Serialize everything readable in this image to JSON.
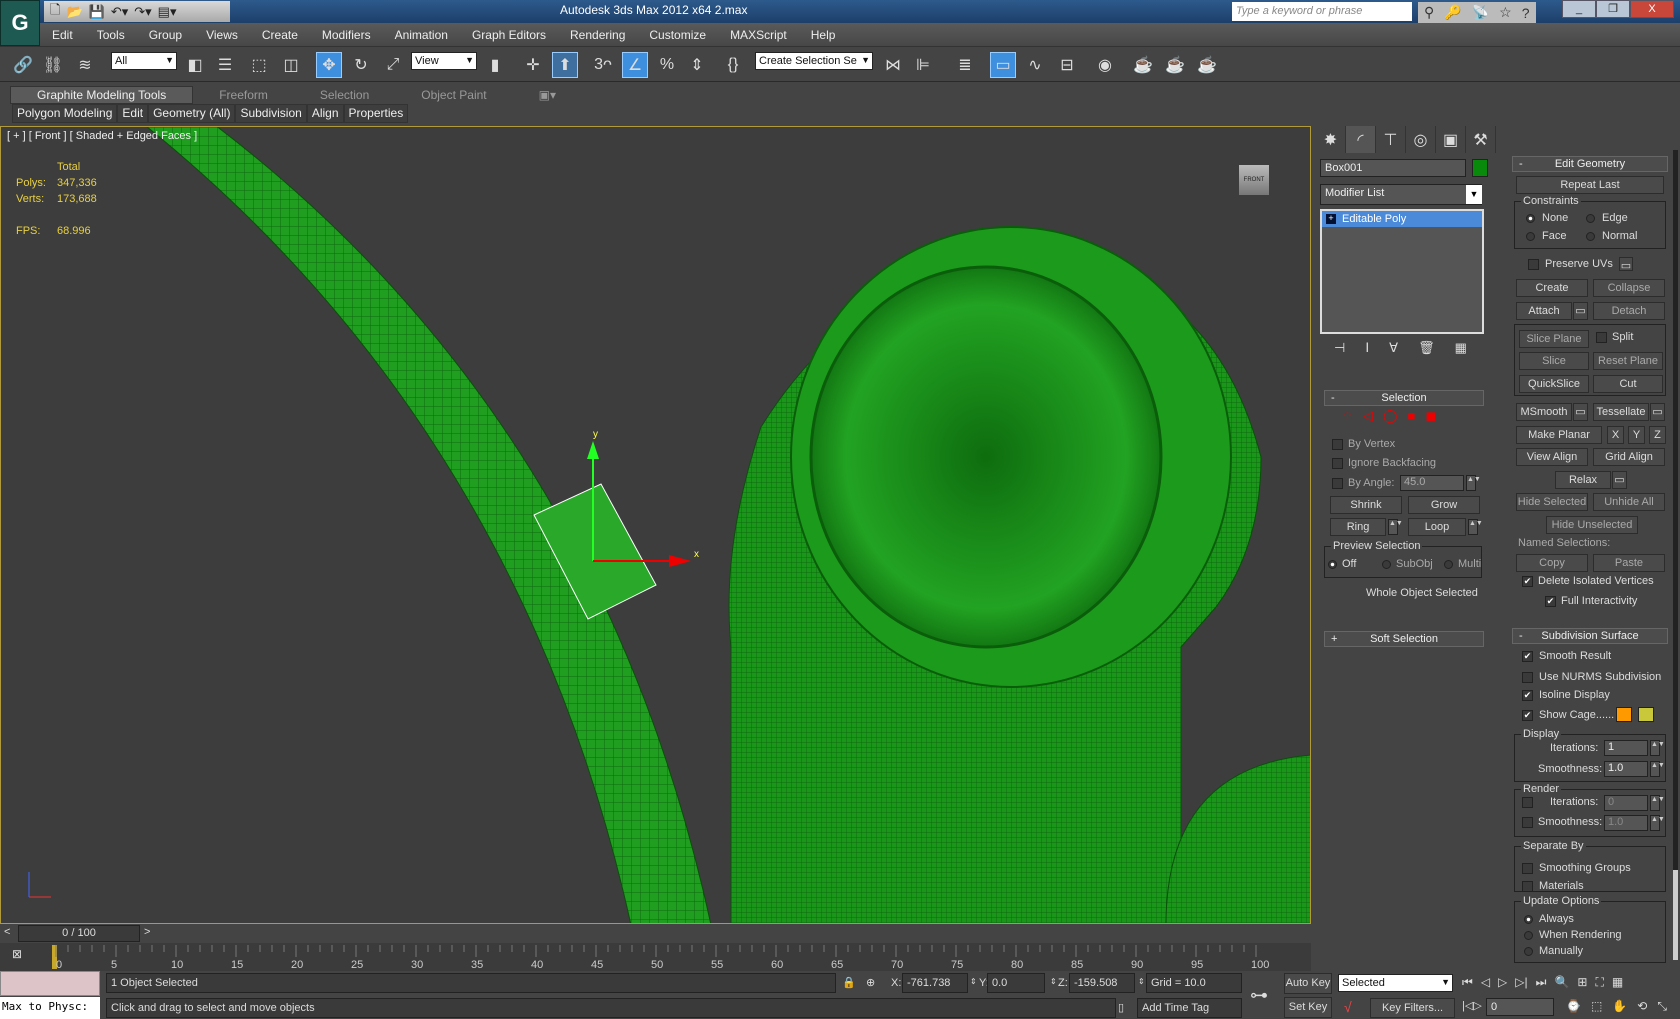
{
  "titlebar": {
    "title": "Autodesk 3ds Max  2012 x64      2.max",
    "search_placeholder": "Type a keyword or phrase",
    "app_button": "G"
  },
  "menu": [
    "Edit",
    "Tools",
    "Group",
    "Views",
    "Create",
    "Modifiers",
    "Animation",
    "Graph Editors",
    "Rendering",
    "Customize",
    "MAXScript",
    "Help"
  ],
  "toolbar": {
    "filter": "All",
    "ref_coord": "View",
    "angle_snap": "3",
    "named_selection": "Create Selection Se"
  },
  "ribbon": {
    "tabs": [
      "Graphite Modeling Tools",
      "Freeform",
      "Selection",
      "Object Paint"
    ],
    "panels": [
      "Polygon Modeling",
      "Edit",
      "Geometry (All)",
      "Subdivision",
      "Align",
      "Properties"
    ]
  },
  "viewport": {
    "label": "[ + ] [ Front ] [ Shaded + Edged Faces ]",
    "stats": {
      "total": "Total",
      "polys_label": "Polys:",
      "polys": "347,336",
      "verts_label": "Verts:",
      "verts": "173,688",
      "fps_label": "FPS:",
      "fps": "68.996"
    },
    "viewcube": "FRONT",
    "gizmo_x": "x",
    "gizmo_y": "y",
    "object_color": "#1fa31f"
  },
  "command_panel": {
    "object_name": "Box001",
    "object_color": "#0a8a0a",
    "modifier_list": "Modifier List",
    "stack": [
      "Editable Poly"
    ],
    "selection": {
      "title": "Selection",
      "by_vertex": "By Vertex",
      "ignore_backfacing": "Ignore Backfacing",
      "by_angle": "By Angle:",
      "angle": "45.0",
      "shrink": "Shrink",
      "grow": "Grow",
      "ring": "Ring",
      "loop": "Loop",
      "preview": "Preview Selection",
      "off": "Off",
      "subobj": "SubObj",
      "multi": "Multi",
      "status": "Whole Object Selected"
    },
    "soft_selection": "Soft Selection",
    "edit_geometry": {
      "title": "Edit Geometry",
      "repeat_last": "Repeat Last",
      "constraints": "Constraints",
      "none": "None",
      "edge": "Edge",
      "face": "Face",
      "normal": "Normal",
      "preserve_uvs": "Preserve UVs",
      "create": "Create",
      "collapse": "Collapse",
      "attach": "Attach",
      "detach": "Detach",
      "slice_plane": "Slice Plane",
      "split": "Split",
      "slice": "Slice",
      "reset_plane": "Reset Plane",
      "quickslice": "QuickSlice",
      "cut": "Cut",
      "msmooth": "MSmooth",
      "tessellate": "Tessellate",
      "make_planar": "Make Planar",
      "x": "X",
      "y": "Y",
      "z": "Z",
      "view_align": "View Align",
      "grid_align": "Grid Align",
      "relax": "Relax",
      "hide_selected": "Hide Selected",
      "unhide_all": "Unhide All",
      "hide_unselected": "Hide Unselected",
      "named_selections": "Named Selections:",
      "copy": "Copy",
      "paste": "Paste",
      "delete_isolated": "Delete Isolated Vertices",
      "full_interactivity": "Full Interactivity"
    },
    "subdivision": {
      "title": "Subdivision Surface",
      "smooth_result": "Smooth Result",
      "use_nurms": "Use NURMS Subdivision",
      "isoline": "Isoline Display",
      "show_cage": "Show Cage......",
      "cage_color1": "#ff9900",
      "cage_color2": "#c8c83a",
      "display": "Display",
      "iterations_label": "Iterations:",
      "iterations": "1",
      "smoothness_label": "Smoothness:",
      "smoothness": "1.0",
      "render": "Render",
      "render_iterations": "0",
      "render_smoothness": "1.0",
      "separate_by": "Separate By",
      "smoothing_groups": "Smoothing Groups",
      "materials": "Materials",
      "update_options": "Update Options",
      "always": "Always",
      "when_rendering": "When Rendering",
      "manually": "Manually"
    }
  },
  "timeline": {
    "frame": "0 / 100",
    "ticks": [
      "0",
      "5",
      "10",
      "15",
      "20",
      "25",
      "30",
      "35",
      "40",
      "45",
      "50",
      "55",
      "60",
      "65",
      "70",
      "75",
      "80",
      "85",
      "90",
      "95",
      "100"
    ]
  },
  "status": {
    "script_listener": "Max to Physc:",
    "selected": "1 Object Selected",
    "prompt": "Click and drag to select and move objects",
    "x_label": "X:",
    "x": "-761.738",
    "y_label": "Y:",
    "y": "0.0",
    "z_label": "Z:",
    "z": "-159.508",
    "grid": "Grid = 10.0",
    "add_time_tag": "Add Time Tag",
    "auto_key": "Auto Key",
    "set_key": "Set Key",
    "key_mode": "Selected",
    "key_filters": "Key Filters...",
    "current_frame": "0"
  }
}
